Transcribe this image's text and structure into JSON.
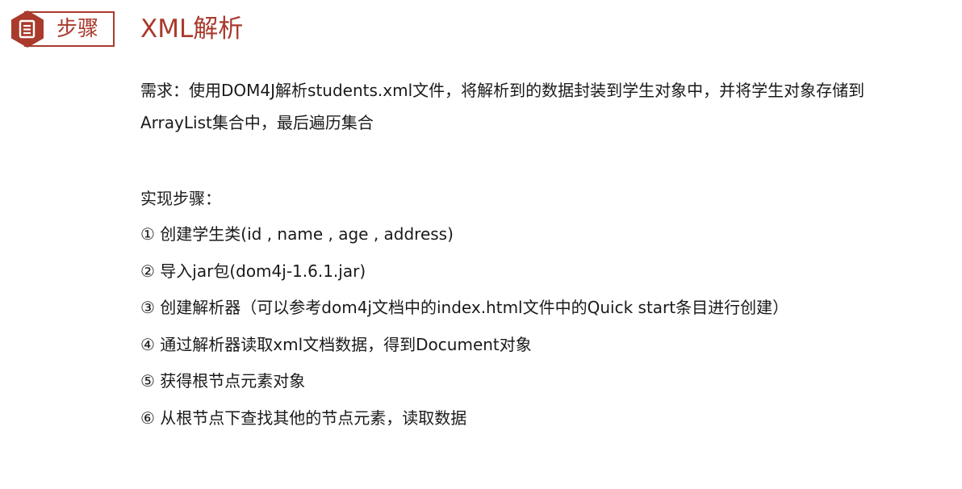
{
  "header": {
    "badge_label": "步骤",
    "badge_icon": "document-icon",
    "title": "XML解析",
    "accent_color": "#a93a2c"
  },
  "requirement": {
    "line1": "需求：使用DOM4J解析students.xml文件，将解析到的数据封装到学生对象中，并将学生对象存储到",
    "line2": "ArrayList集合中，最后遍历集合"
  },
  "steps_heading": "实现步骤：",
  "steps": [
    "① 创建学生类(id , name , age , address)",
    "② 导入jar包(dom4j-1.6.1.jar)",
    "③ 创建解析器（可以参考dom4j文档中的index.html文件中的Quick start条目进行创建）",
    "④ 通过解析器读取xml文档数据，得到Document对象",
    "⑤ 获得根节点元素对象",
    "⑥ 从根节点下查找其他的节点元素，读取数据"
  ]
}
